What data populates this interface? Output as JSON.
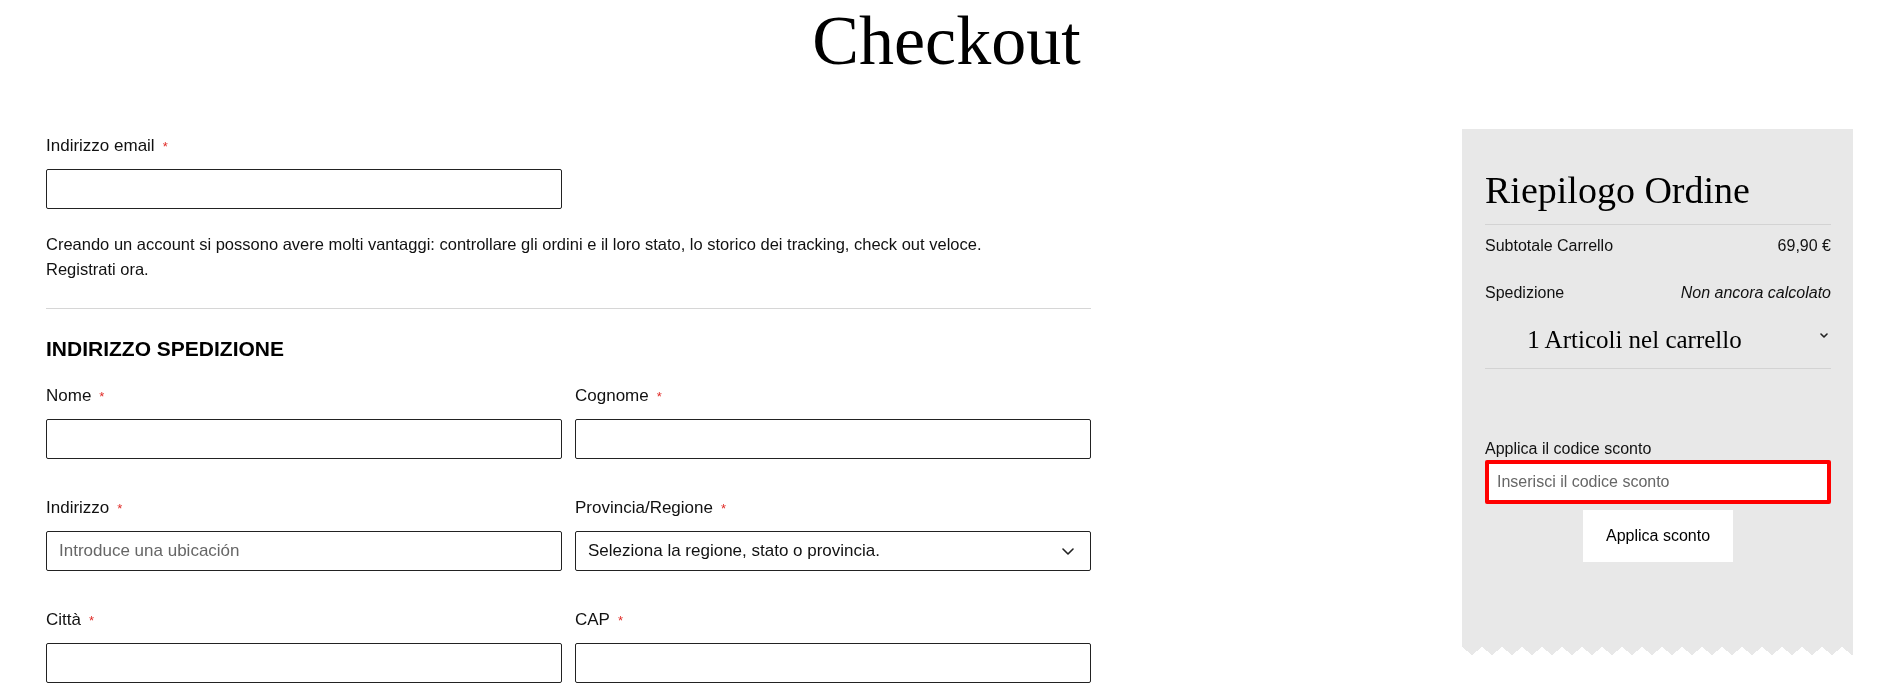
{
  "page": {
    "title": "Checkout"
  },
  "contact": {
    "email": {
      "label": "Indirizzo email",
      "required_mark": "*"
    },
    "note": "Creando un account si possono avere molti vantaggi: controllare gli ordini e il loro stato, lo storico dei tracking, check out veloce.",
    "register_link": "Registrati ora."
  },
  "shipping": {
    "heading": "INDIRIZZO SPEDIZIONE",
    "fields": [
      {
        "kind": "text",
        "label": "Nome",
        "required_mark": "*"
      },
      {
        "kind": "text",
        "label": "Cognome",
        "required_mark": "*"
      },
      {
        "kind": "text",
        "label": "Indirizzo",
        "required_mark": "*",
        "placeholder": "Introduce una ubicación"
      },
      {
        "kind": "select",
        "label": "Provincia/Regione",
        "required_mark": "*",
        "value": "Seleziona la regione, stato o provincia."
      },
      {
        "kind": "text",
        "label": "Città",
        "required_mark": "*"
      },
      {
        "kind": "text",
        "label": "CAP",
        "required_mark": "*"
      }
    ]
  },
  "summary": {
    "title": "Riepilogo Ordine",
    "rows": [
      {
        "kind": "amount",
        "label": "Subtotale Carrello",
        "value": "69,90 €"
      },
      {
        "kind": "pending",
        "label": "Spedizione",
        "value": "Non ancora calcolato"
      }
    ],
    "items_toggle": {
      "label": "1 Articoli nel carrello",
      "expanded": false
    },
    "discount": {
      "label": "Applica il codice sconto",
      "placeholder": "Inserisci il codice sconto",
      "highlighted": true,
      "button": "Applica sconto"
    }
  }
}
